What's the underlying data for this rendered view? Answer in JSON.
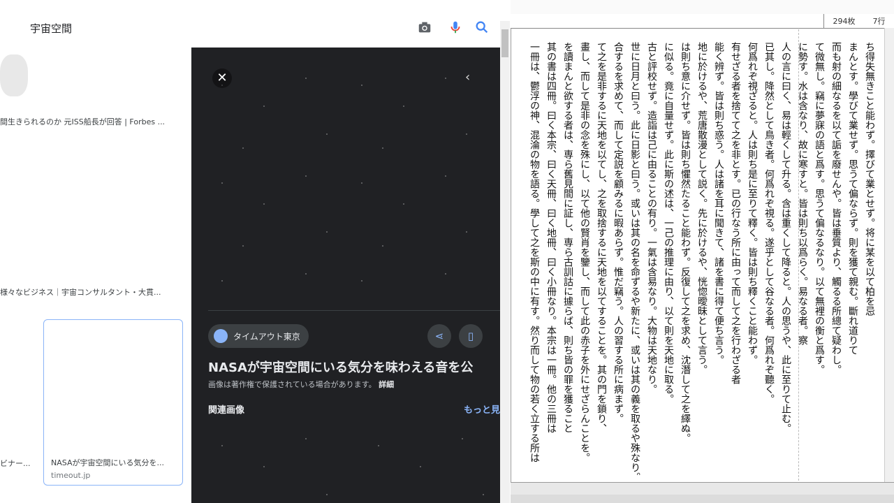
{
  "search": {
    "query": "宇宙空間"
  },
  "results": {
    "captions": [
      "間生きられるのか 元ISS船長が回答 | Forbes ...",
      "様々なビジネス｜宇宙コンサルタント・大貫...",
      "ビナー...",
      "NASAが宇宙空間にいる気分を...",
      "timeout.jp"
    ]
  },
  "preview": {
    "source": "タイムアウト東京",
    "title": "NASAが宇宙空間にいる気分を味わえる音を公",
    "copyright": "画像は著作権で保護されている場合があります。",
    "details_link": "詳細",
    "related_heading": "関連画像",
    "more_link": "もっと見"
  },
  "editor": {
    "status_sheets": "294枚",
    "status_lines": "7行",
    "columns": [
      "ち得失無きこと能わず。擇びて業とせず。将に某を以て柏を忌",
      "まんとす。學びて業せず。思うて偏ならず。則を獲て親む。斷れ道りて",
      "而も射の細なるを以て詬を廢せんや。皆は垂質より、觸るる所總て疑わし。",
      "て微無し。竊に夢寐の語と爲す。思うて偏なるなり。以て無裡の衡と爲す。",
      "に勢す。水は含なり、故に寒すと。皆は則ち以爲らく。易なる者。察",
      "人の言に曰く、易は輕くして升る。含は重くして降ると。人の思うや、此に至りて止む。",
      "已其し。降然として鳥き者。何爲れぞ視る。遂乎として谷なる者。何爲れぞ聽く。",
      "何爲れぞ視ざると。人は則ち是に至りて釋く。皆は則ち釋くこと能わず。",
      "有せざる者を捨てて之を非とす。已の行なう所に由って而して之を行わざる者",
      "能く辨ず。皆は則ち惑う。人は諸を耳に聞きて、諸を書に得て便ち言う。",
      "地に於けるや、荒唐散漫として説く。先に於けるや、恍惚曖昧として言う。",
      "は則ち意に介せず。皆は則ち懼然たること能わず。反復して之を求め、沈潛して之を繹ぬ。",
      "に似る。竟に自量せず。此に斯の述は、一己の推理に由り、以て則を天地に取る。",
      "古と評校せず。造詣は己に由ることの有り。一氣は含易なり。大物は天地なり。",
      "世に日月と曰う。此に日影と曰う。或いは其の名を命ずるや新たに、或いは其の義を取るや殊なり。",
      "合するを求めて、而して定説を顧みるに暇あらず。惟だ竊う。人の習する所に病まず。",
      "て之を是非するに天地を以てし、之を取捨するに天地を以てすることを。其の門を鎖り、",
      "畫し、而して是非の念を殊にし、以て他の賢肖を鑒し、而して此の赤子を外にせざらんことを。",
      "を讀まんと欲する者は、専ら舊見間に証し、専ら古訓詁に據らば、則ち皆の罪を獲ること",
      "其の書は四冊。曰く本宗、曰く天冊、曰く地冊、曰く小冊なり。本宗は一冊。他の三冊は",
      "一冊は、鬱浮の神、混淪の物を語る。學して之を斯の中に有す。然り而して物の若く立する所は"
    ]
  }
}
